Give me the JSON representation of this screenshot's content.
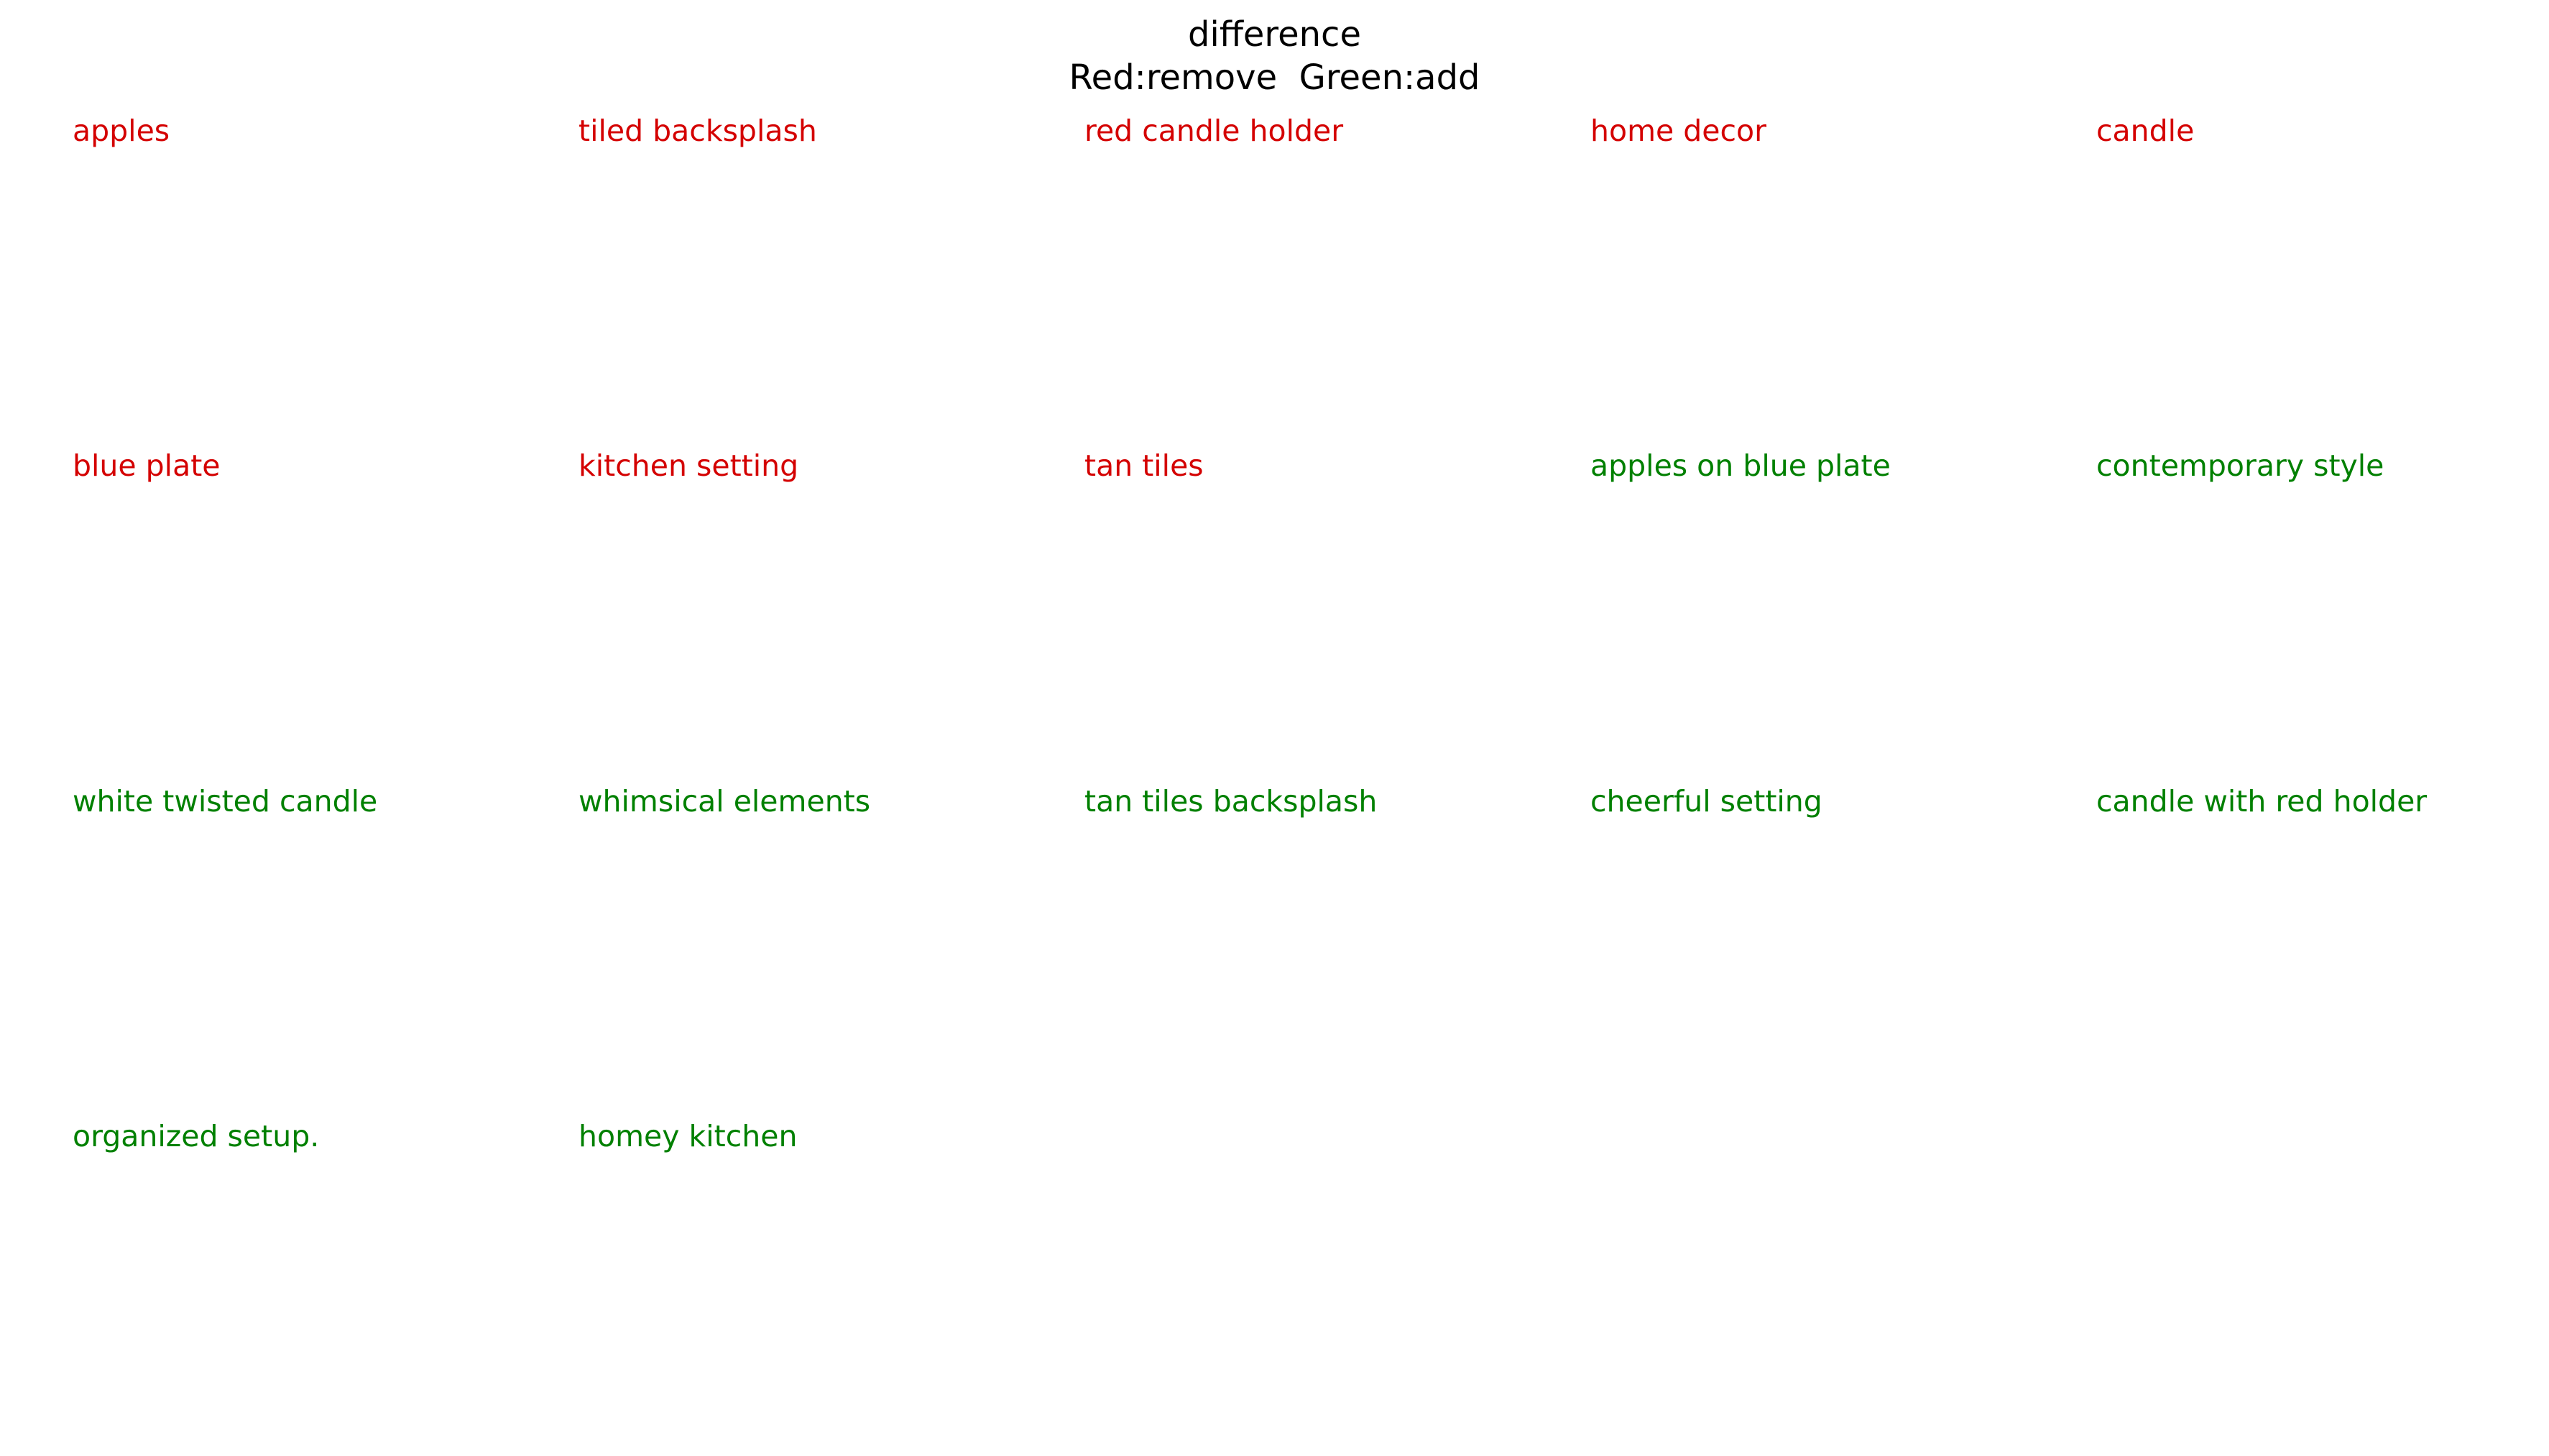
{
  "title": "difference",
  "subtitle": "Red:remove  Green:add",
  "colors": {
    "remove": "#d40000",
    "add": "#008000"
  },
  "items": [
    {
      "text": "apples",
      "kind": "remove"
    },
    {
      "text": "tiled backsplash",
      "kind": "remove"
    },
    {
      "text": "red candle holder",
      "kind": "remove"
    },
    {
      "text": "home decor",
      "kind": "remove"
    },
    {
      "text": "candle",
      "kind": "remove"
    },
    {
      "text": "blue plate",
      "kind": "remove"
    },
    {
      "text": "kitchen setting",
      "kind": "remove"
    },
    {
      "text": "tan tiles",
      "kind": "remove"
    },
    {
      "text": "apples on blue plate",
      "kind": "add"
    },
    {
      "text": "contemporary style",
      "kind": "add"
    },
    {
      "text": "white twisted candle",
      "kind": "add"
    },
    {
      "text": "whimsical elements",
      "kind": "add"
    },
    {
      "text": "tan tiles backsplash",
      "kind": "add"
    },
    {
      "text": "cheerful setting",
      "kind": "add"
    },
    {
      "text": "candle with red holder",
      "kind": "add"
    },
    {
      "text": "organized setup.",
      "kind": "add"
    },
    {
      "text": "homey kitchen",
      "kind": "add"
    }
  ]
}
